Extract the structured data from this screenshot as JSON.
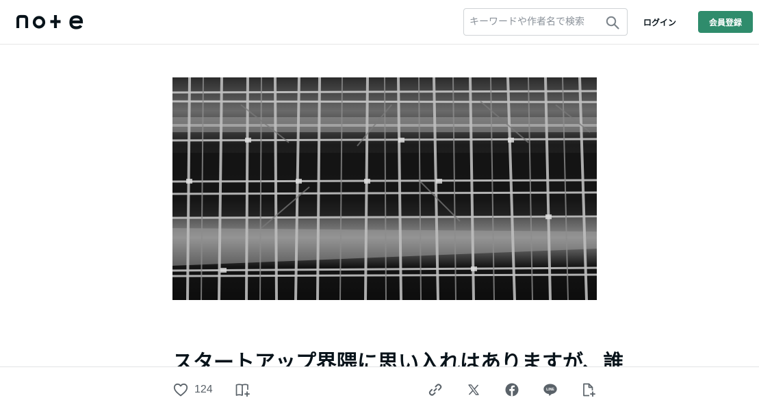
{
  "header": {
    "logo": "note",
    "search_placeholder": "キーワードや作者名で検索",
    "login_label": "ログイン",
    "signup_label": "会員登録",
    "brand_color": "#2f8c6c"
  },
  "article": {
    "title": "スタートアップ界隈に思い入れはありますが、誰"
  },
  "actions": {
    "like_count": "124",
    "icons": [
      "heart-icon",
      "magazine-add-icon",
      "link-icon",
      "x-icon",
      "facebook-icon",
      "line-icon",
      "note-add-icon"
    ]
  }
}
